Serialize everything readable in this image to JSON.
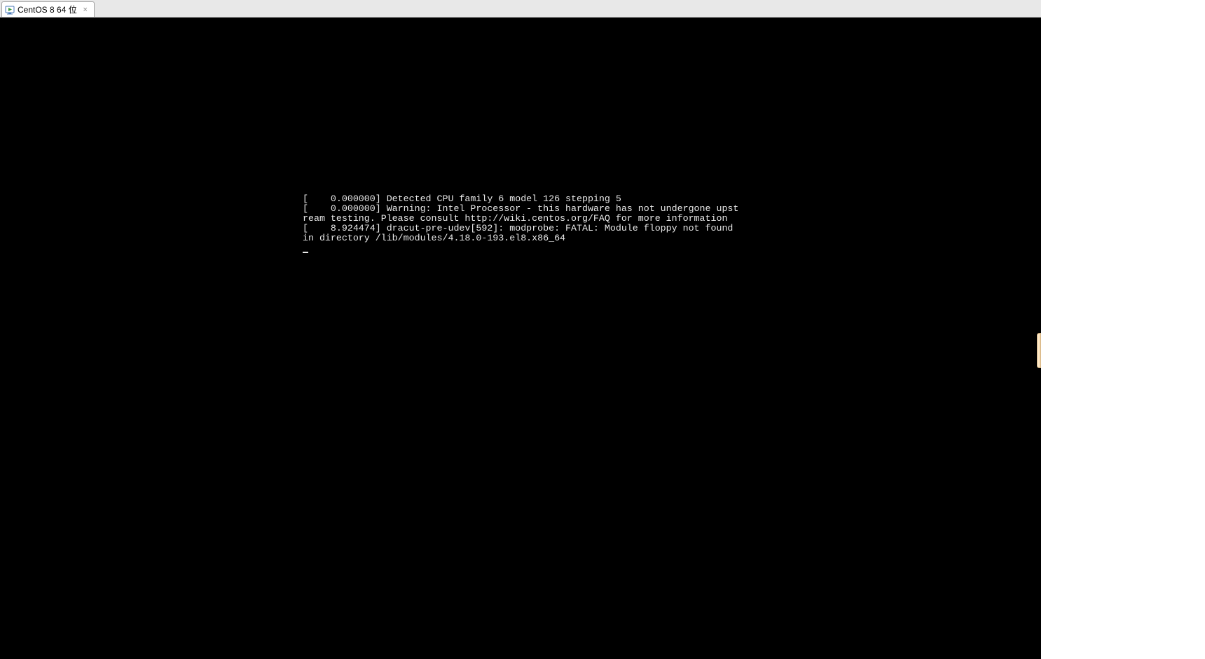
{
  "tab": {
    "label": "CentOS 8 64 位",
    "icon": "vm-power-icon",
    "close": "×"
  },
  "console": {
    "lines": [
      "[    0.000000] Detected CPU family 6 model 126 stepping 5",
      "[    0.000000] Warning: Intel Processor - this hardware has not undergone upstream testing. Please consult http://wiki.centos.org/FAQ for more information",
      "[    8.924474] dracut-pre-udev[592]: modprobe: FATAL: Module floppy not found in directory /lib/modules/4.18.0-193.el8.x86_64"
    ]
  }
}
